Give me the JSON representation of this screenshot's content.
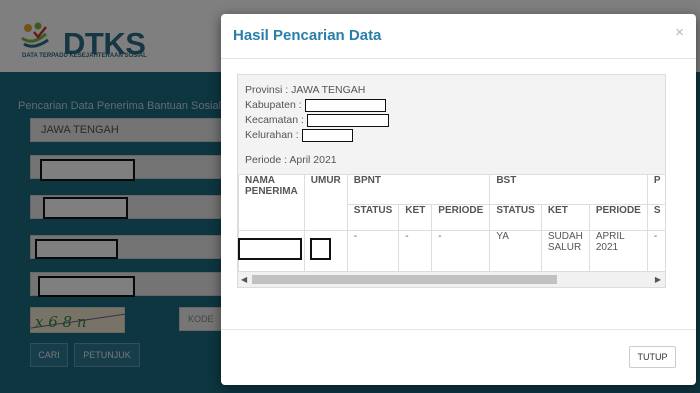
{
  "background": {
    "logo": {
      "name": "DTKS",
      "subtitle": "DATA TERPADU KESEJAHTERAAN SOSIAL"
    },
    "form": {
      "title": "Pencarian Data Penerima Bantuan Sosial",
      "province_value": "JAWA TENGAH",
      "captcha_text": "x 6 8 n",
      "kode_placeholder": "KODE"
    },
    "buttons": {
      "cari": "CARI",
      "petunjuk": "PETUNJUK"
    }
  },
  "modal": {
    "title": "Hasil Pencarian Data",
    "close": "×",
    "info": {
      "provinsi": "Provinsi : JAWA TENGAH",
      "kabupaten_label": "Kabupaten :",
      "kecamatan_label": "Kecamatan :",
      "kelurahan_label": "Kelurahan :",
      "periode": "Periode : April 2021"
    },
    "table": {
      "col_nama": "NAMA PENERIMA",
      "col_umur": "UMUR",
      "group_bpnt": "BPNT",
      "group_bst": "BST",
      "group_p": "P",
      "sub": {
        "status": "STATUS",
        "ket": "KET",
        "periode": "PERIODE",
        "s": "S"
      },
      "row": {
        "bpnt_status": "-",
        "bpnt_ket": "-",
        "bpnt_periode": "-",
        "bst_status": "YA",
        "bst_ket": "SUDAH SALUR",
        "bst_periode": "APRIL 2021",
        "p_s": "-"
      }
    },
    "footer": {
      "tutup": "TUTUP"
    }
  },
  "colors": {
    "accent": "#2a7fa8",
    "teal_bg": "#1b6d83"
  }
}
